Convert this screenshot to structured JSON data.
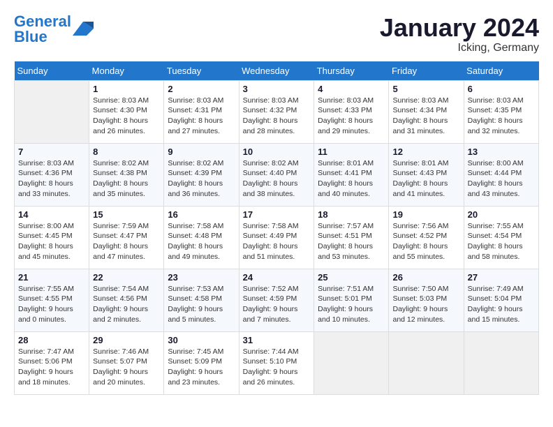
{
  "header": {
    "logo_line1": "General",
    "logo_line2": "Blue",
    "month_title": "January 2024",
    "location": "Icking, Germany"
  },
  "days_of_week": [
    "Sunday",
    "Monday",
    "Tuesday",
    "Wednesday",
    "Thursday",
    "Friday",
    "Saturday"
  ],
  "weeks": [
    [
      {
        "num": "",
        "empty": true
      },
      {
        "num": "1",
        "sunrise": "Sunrise: 8:03 AM",
        "sunset": "Sunset: 4:30 PM",
        "daylight": "Daylight: 8 hours and 26 minutes."
      },
      {
        "num": "2",
        "sunrise": "Sunrise: 8:03 AM",
        "sunset": "Sunset: 4:31 PM",
        "daylight": "Daylight: 8 hours and 27 minutes."
      },
      {
        "num": "3",
        "sunrise": "Sunrise: 8:03 AM",
        "sunset": "Sunset: 4:32 PM",
        "daylight": "Daylight: 8 hours and 28 minutes."
      },
      {
        "num": "4",
        "sunrise": "Sunrise: 8:03 AM",
        "sunset": "Sunset: 4:33 PM",
        "daylight": "Daylight: 8 hours and 29 minutes."
      },
      {
        "num": "5",
        "sunrise": "Sunrise: 8:03 AM",
        "sunset": "Sunset: 4:34 PM",
        "daylight": "Daylight: 8 hours and 31 minutes."
      },
      {
        "num": "6",
        "sunrise": "Sunrise: 8:03 AM",
        "sunset": "Sunset: 4:35 PM",
        "daylight": "Daylight: 8 hours and 32 minutes."
      }
    ],
    [
      {
        "num": "7",
        "sunrise": "Sunrise: 8:03 AM",
        "sunset": "Sunset: 4:36 PM",
        "daylight": "Daylight: 8 hours and 33 minutes."
      },
      {
        "num": "8",
        "sunrise": "Sunrise: 8:02 AM",
        "sunset": "Sunset: 4:38 PM",
        "daylight": "Daylight: 8 hours and 35 minutes."
      },
      {
        "num": "9",
        "sunrise": "Sunrise: 8:02 AM",
        "sunset": "Sunset: 4:39 PM",
        "daylight": "Daylight: 8 hours and 36 minutes."
      },
      {
        "num": "10",
        "sunrise": "Sunrise: 8:02 AM",
        "sunset": "Sunset: 4:40 PM",
        "daylight": "Daylight: 8 hours and 38 minutes."
      },
      {
        "num": "11",
        "sunrise": "Sunrise: 8:01 AM",
        "sunset": "Sunset: 4:41 PM",
        "daylight": "Daylight: 8 hours and 40 minutes."
      },
      {
        "num": "12",
        "sunrise": "Sunrise: 8:01 AM",
        "sunset": "Sunset: 4:43 PM",
        "daylight": "Daylight: 8 hours and 41 minutes."
      },
      {
        "num": "13",
        "sunrise": "Sunrise: 8:00 AM",
        "sunset": "Sunset: 4:44 PM",
        "daylight": "Daylight: 8 hours and 43 minutes."
      }
    ],
    [
      {
        "num": "14",
        "sunrise": "Sunrise: 8:00 AM",
        "sunset": "Sunset: 4:45 PM",
        "daylight": "Daylight: 8 hours and 45 minutes."
      },
      {
        "num": "15",
        "sunrise": "Sunrise: 7:59 AM",
        "sunset": "Sunset: 4:47 PM",
        "daylight": "Daylight: 8 hours and 47 minutes."
      },
      {
        "num": "16",
        "sunrise": "Sunrise: 7:58 AM",
        "sunset": "Sunset: 4:48 PM",
        "daylight": "Daylight: 8 hours and 49 minutes."
      },
      {
        "num": "17",
        "sunrise": "Sunrise: 7:58 AM",
        "sunset": "Sunset: 4:49 PM",
        "daylight": "Daylight: 8 hours and 51 minutes."
      },
      {
        "num": "18",
        "sunrise": "Sunrise: 7:57 AM",
        "sunset": "Sunset: 4:51 PM",
        "daylight": "Daylight: 8 hours and 53 minutes."
      },
      {
        "num": "19",
        "sunrise": "Sunrise: 7:56 AM",
        "sunset": "Sunset: 4:52 PM",
        "daylight": "Daylight: 8 hours and 55 minutes."
      },
      {
        "num": "20",
        "sunrise": "Sunrise: 7:55 AM",
        "sunset": "Sunset: 4:54 PM",
        "daylight": "Daylight: 8 hours and 58 minutes."
      }
    ],
    [
      {
        "num": "21",
        "sunrise": "Sunrise: 7:55 AM",
        "sunset": "Sunset: 4:55 PM",
        "daylight": "Daylight: 9 hours and 0 minutes."
      },
      {
        "num": "22",
        "sunrise": "Sunrise: 7:54 AM",
        "sunset": "Sunset: 4:56 PM",
        "daylight": "Daylight: 9 hours and 2 minutes."
      },
      {
        "num": "23",
        "sunrise": "Sunrise: 7:53 AM",
        "sunset": "Sunset: 4:58 PM",
        "daylight": "Daylight: 9 hours and 5 minutes."
      },
      {
        "num": "24",
        "sunrise": "Sunrise: 7:52 AM",
        "sunset": "Sunset: 4:59 PM",
        "daylight": "Daylight: 9 hours and 7 minutes."
      },
      {
        "num": "25",
        "sunrise": "Sunrise: 7:51 AM",
        "sunset": "Sunset: 5:01 PM",
        "daylight": "Daylight: 9 hours and 10 minutes."
      },
      {
        "num": "26",
        "sunrise": "Sunrise: 7:50 AM",
        "sunset": "Sunset: 5:03 PM",
        "daylight": "Daylight: 9 hours and 12 minutes."
      },
      {
        "num": "27",
        "sunrise": "Sunrise: 7:49 AM",
        "sunset": "Sunset: 5:04 PM",
        "daylight": "Daylight: 9 hours and 15 minutes."
      }
    ],
    [
      {
        "num": "28",
        "sunrise": "Sunrise: 7:47 AM",
        "sunset": "Sunset: 5:06 PM",
        "daylight": "Daylight: 9 hours and 18 minutes."
      },
      {
        "num": "29",
        "sunrise": "Sunrise: 7:46 AM",
        "sunset": "Sunset: 5:07 PM",
        "daylight": "Daylight: 9 hours and 20 minutes."
      },
      {
        "num": "30",
        "sunrise": "Sunrise: 7:45 AM",
        "sunset": "Sunset: 5:09 PM",
        "daylight": "Daylight: 9 hours and 23 minutes."
      },
      {
        "num": "31",
        "sunrise": "Sunrise: 7:44 AM",
        "sunset": "Sunset: 5:10 PM",
        "daylight": "Daylight: 9 hours and 26 minutes."
      },
      {
        "num": "",
        "empty": true
      },
      {
        "num": "",
        "empty": true
      },
      {
        "num": "",
        "empty": true
      }
    ]
  ]
}
